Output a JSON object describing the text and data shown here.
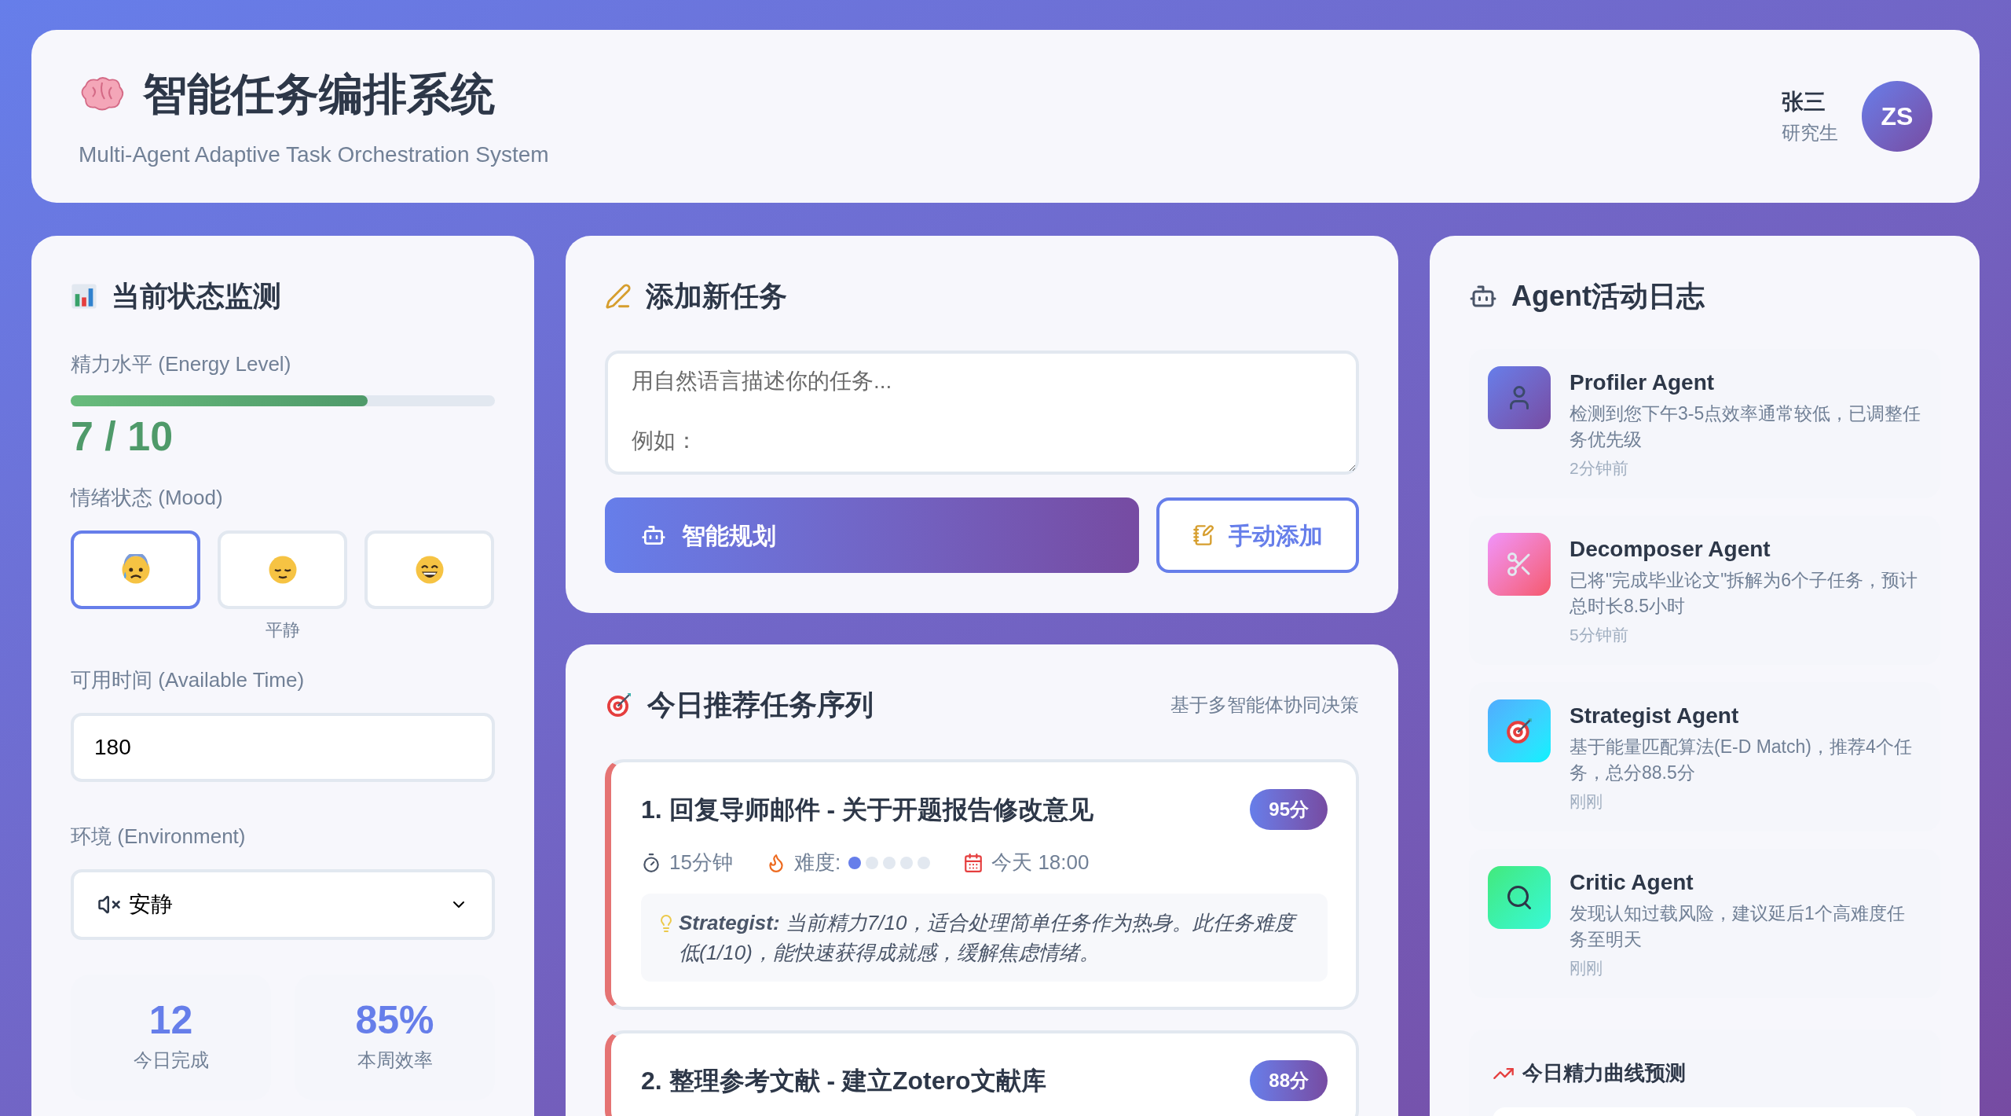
{
  "header": {
    "title": "智能任务编排系统",
    "subtitle": "Multi-Agent Adaptive Task Orchestration System",
    "user": {
      "name": "张三",
      "role": "研究生",
      "initials": "ZS"
    }
  },
  "status": {
    "title": "当前状态监测",
    "energy": {
      "label": "精力水平 (Energy Level)",
      "level": 0.7,
      "reading": "7 / 10"
    },
    "mood": {
      "label": "情绪状态 (Mood)",
      "options": [
        {
          "kind": "anxious",
          "selected": true
        },
        {
          "kind": "calm",
          "selected": false,
          "caption": "平静"
        },
        {
          "kind": "happy",
          "selected": false
        }
      ]
    },
    "time": {
      "label": "可用时间 (Available Time)",
      "value": "180"
    },
    "environment": {
      "label": "环境 (Environment)",
      "value": "安静"
    },
    "stats": [
      {
        "value": "12",
        "label": "今日完成"
      },
      {
        "value": "85%",
        "label": "本周效率"
      }
    ]
  },
  "add_task": {
    "title": "添加新任务",
    "placeholder": "用自然语言描述你的任务...\n\n例如：",
    "buttons": [
      {
        "kind": "primary",
        "label": "智能规划"
      },
      {
        "kind": "secondary",
        "label": "手动添加"
      }
    ]
  },
  "recommendations": {
    "title": "今日推荐任务序列",
    "note": "基于多智能体协同决策",
    "tasks": [
      {
        "title": "1. 回复导师邮件 - 关于开题报告修改意见",
        "score": "95分",
        "duration": "15分钟",
        "difficulty_label": "难度:",
        "stars": 1,
        "deadline": "今天 18:00",
        "advice": "**Strategist:** 当前精力7/10，适合处理简单任务作为热身。此任务难度低(1/10)，能快速获得成就感，缓解焦虑情绪。"
      },
      {
        "title": "2. 整理参考文献 - 建立Zotero文献库",
        "score": "88分"
      }
    ]
  },
  "agent_log": {
    "title": "Agent活动日志",
    "items": [
      {
        "kind": "profiler",
        "name": "Profiler Agent",
        "message": "检测到您下午3-5点效率通常较低，已调整任务优先级",
        "time": "2分钟前"
      },
      {
        "kind": "decomposer",
        "name": "Decomposer Agent",
        "message": "已将\"完成毕业论文\"拆解为6个子任务，预计总时长8.5小时",
        "time": "5分钟前"
      },
      {
        "kind": "strategist",
        "name": "Strategist Agent",
        "message": "基于能量匹配算法(E-D Match)，推荐4个任务，总分88.5分",
        "time": "刚刚"
      },
      {
        "kind": "critic",
        "name": "Critic Agent",
        "message": "发现认知过载风险，建议延后1个高难度任务至明天",
        "time": "刚刚"
      }
    ],
    "forecast": {
      "title": "今日精力曲线预测"
    }
  }
}
